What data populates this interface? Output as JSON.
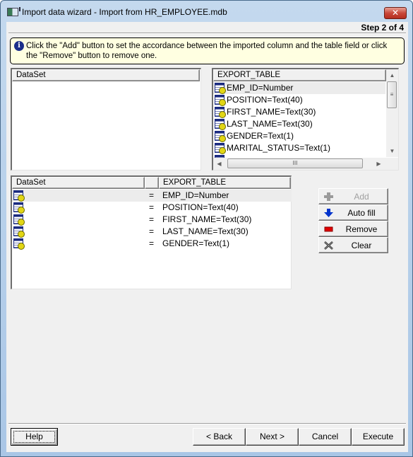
{
  "window": {
    "title": "Import data wizard - Import from HR_EMPLOYEE.mdb",
    "close_label": "✕",
    "step_label": "Step 2 of 4"
  },
  "info": {
    "icon": "info-icon",
    "text": "Click the \"Add\" button to set the accordance between the imported column and the table field or click the \"Remove\" button to remove one."
  },
  "source_list": {
    "header": "DataSet",
    "items": []
  },
  "target_list": {
    "header": "EXPORT_TABLE",
    "items": [
      "EMP_ID=Number",
      "POSITION=Text(40)",
      "FIRST_NAME=Text(30)",
      "LAST_NAME=Text(30)",
      "GENDER=Text(1)",
      "MARITAL_STATUS=Text(1)"
    ],
    "selected_index": 0
  },
  "mapping": {
    "headers": [
      "DataSet",
      "",
      "EXPORT_TABLE"
    ],
    "rows": [
      {
        "source": "",
        "op": "=",
        "target": "EMP_ID=Number"
      },
      {
        "source": "",
        "op": "=",
        "target": "POSITION=Text(40)"
      },
      {
        "source": "",
        "op": "=",
        "target": "FIRST_NAME=Text(30)"
      },
      {
        "source": "",
        "op": "=",
        "target": "LAST_NAME=Text(30)"
      },
      {
        "source": "",
        "op": "=",
        "target": "GENDER=Text(1)"
      }
    ],
    "selected_index": 0
  },
  "side_buttons": {
    "add": "Add",
    "auto_fill": "Auto fill",
    "remove": "Remove",
    "clear": "Clear"
  },
  "footer": {
    "help": "Help",
    "back": "< Back",
    "next": "Next >",
    "cancel": "Cancel",
    "execute": "Execute"
  },
  "colors": {
    "info_bg": "#ffffe1",
    "close_red": "#c9483a",
    "auto_fill_arrow": "#0033cc",
    "remove_red": "#e00000"
  }
}
